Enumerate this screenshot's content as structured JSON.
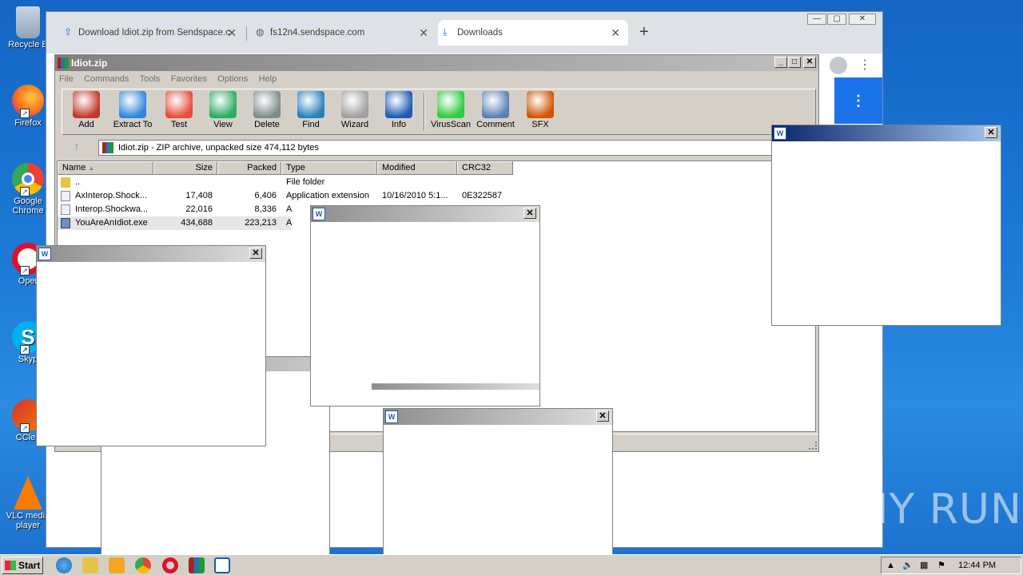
{
  "desktop": {
    "icons": [
      {
        "label": "Recycle B",
        "icon": "recycle-bin-icon"
      },
      {
        "label": "Firefox",
        "icon": "firefox-icon"
      },
      {
        "label": "Google Chrome",
        "icon": "chrome-icon"
      },
      {
        "label": "Oper",
        "icon": "opera-icon"
      },
      {
        "label": "Skyp",
        "icon": "skype-icon"
      },
      {
        "label": "CClea",
        "icon": "ccleaner-icon"
      },
      {
        "label": "VLC media player",
        "icon": "vlc-icon"
      }
    ],
    "watermark": "ANY RUN"
  },
  "browser": {
    "tabs": [
      {
        "label": "Download Idiot.zip from Sendspace.c",
        "icon": "upload-arrow-icon"
      },
      {
        "label": "fs12n4.sendspace.com",
        "icon": "globe-icon"
      },
      {
        "label": "Downloads",
        "icon": "download-icon"
      }
    ],
    "new_tab": "+",
    "controls": {
      "minimize": "—",
      "maximize": "▢",
      "close": "✕"
    },
    "menu_glyph": "⋮"
  },
  "winrar": {
    "title": "Idiot.zip",
    "menu": [
      "File",
      "Commands",
      "Tools",
      "Favorites",
      "Options",
      "Help"
    ],
    "tools": [
      {
        "label": "Add",
        "color": "#c0392b"
      },
      {
        "label": "Extract To",
        "color": "#2e86de"
      },
      {
        "label": "Test",
        "color": "#e74c3c"
      },
      {
        "label": "View",
        "color": "#27ae60"
      },
      {
        "label": "Delete",
        "color": "#7f8c8d"
      },
      {
        "label": "Find",
        "color": "#2980b9"
      },
      {
        "label": "Wizard",
        "color": "#a0a0a0"
      },
      {
        "label": "Info",
        "color": "#1e5bb4"
      },
      {
        "label": "VirusScan",
        "color": "#2ecc40"
      },
      {
        "label": "Comment",
        "color": "#5b7fb4"
      },
      {
        "label": "SFX",
        "color": "#d35400"
      }
    ],
    "address": "Idiot.zip - ZIP archive, unpacked size 474,112 bytes",
    "columns": [
      "Name",
      "Size",
      "Packed",
      "Type",
      "Modified",
      "CRC32"
    ],
    "rows": [
      {
        "name": "..",
        "size": "",
        "packed": "",
        "type": "File folder",
        "modified": "",
        "crc": ""
      },
      {
        "name": "AxInterop.Shock...",
        "size": "17,408",
        "packed": "6,406",
        "type": "Application extension",
        "modified": "10/16/2010 5:1...",
        "crc": "0E322587"
      },
      {
        "name": "Interop.Shockwa...",
        "size": "22,016",
        "packed": "8,336",
        "type": "A",
        "modified": "",
        "crc": ""
      },
      {
        "name": "YouAreAnIdiot.exe",
        "size": "434,688",
        "packed": "223,213",
        "type": "A",
        "modified": "",
        "crc": ""
      }
    ]
  },
  "popup": {
    "icon_label": "W",
    "close": "✕"
  },
  "taskbar": {
    "start": "Start",
    "time": "12:44 PM"
  }
}
